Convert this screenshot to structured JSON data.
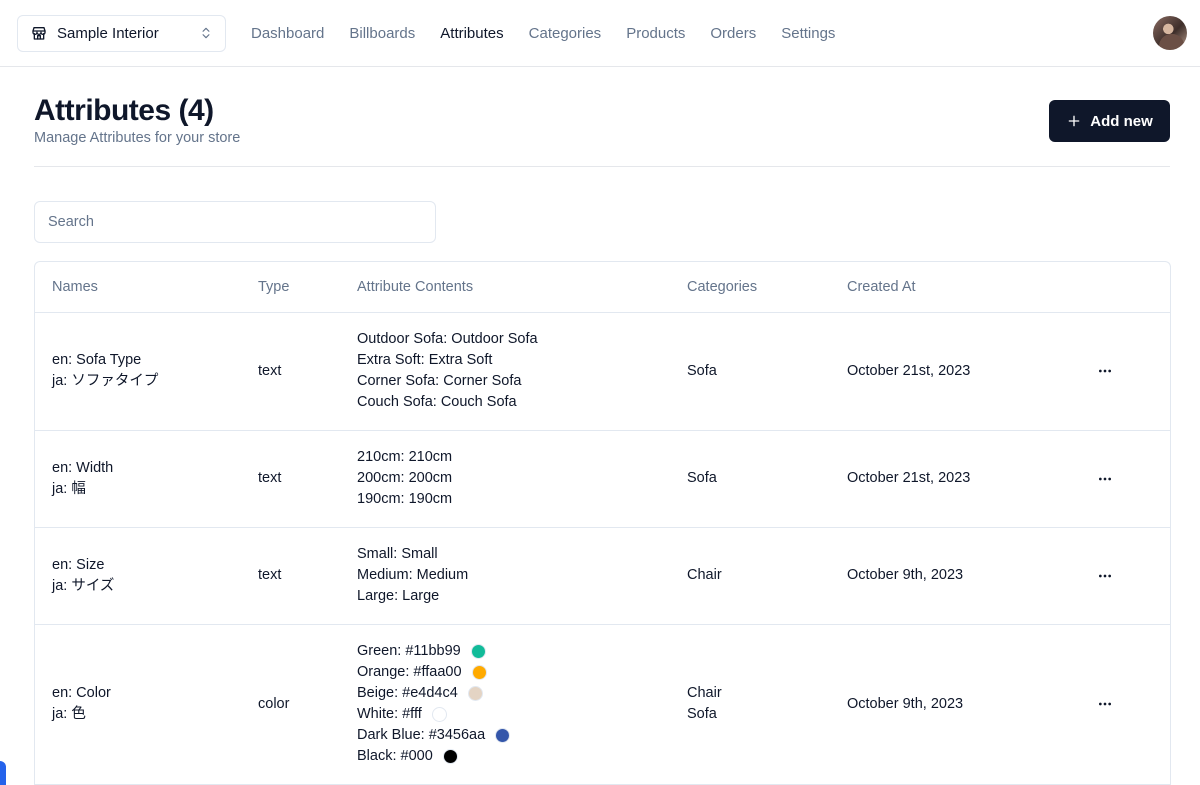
{
  "store_switcher": {
    "name": "Sample Interior",
    "icon": "store-icon",
    "chevron_icon": "chevrons-up-down-icon"
  },
  "nav": [
    {
      "label": "Dashboard",
      "active": false
    },
    {
      "label": "Billboards",
      "active": false
    },
    {
      "label": "Attributes",
      "active": true
    },
    {
      "label": "Categories",
      "active": false
    },
    {
      "label": "Products",
      "active": false
    },
    {
      "label": "Orders",
      "active": false
    },
    {
      "label": "Settings",
      "active": false
    }
  ],
  "header": {
    "title": "Attributes (4)",
    "description": "Manage Attributes for your store",
    "add_button": "Add new"
  },
  "search": {
    "placeholder": "Search",
    "value": ""
  },
  "table": {
    "columns": [
      "Names",
      "Type",
      "Attribute Contents",
      "Categories",
      "Created At"
    ],
    "rows": [
      {
        "names": [
          "en: Sofa Type",
          "ja: ソファタイプ"
        ],
        "type": "text",
        "contents": [
          {
            "label": "Outdoor Sofa: Outdoor Sofa"
          },
          {
            "label": "Extra Soft: Extra Soft"
          },
          {
            "label": "Corner Sofa: Corner Sofa"
          },
          {
            "label": "Couch Sofa: Couch Sofa"
          }
        ],
        "categories": [
          "Sofa"
        ],
        "created_at": "October 21st, 2023"
      },
      {
        "names": [
          "en: Width",
          "ja: 幅"
        ],
        "type": "text",
        "contents": [
          {
            "label": "210cm: 210cm"
          },
          {
            "label": "200cm: 200cm"
          },
          {
            "label": "190cm: 190cm"
          }
        ],
        "categories": [
          "Sofa"
        ],
        "created_at": "October 21st, 2023"
      },
      {
        "names": [
          "en: Size",
          "ja: サイズ"
        ],
        "type": "text",
        "contents": [
          {
            "label": "Small: Small"
          },
          {
            "label": "Medium: Medium"
          },
          {
            "label": "Large: Large"
          }
        ],
        "categories": [
          "Chair"
        ],
        "created_at": "October 9th, 2023"
      },
      {
        "names": [
          "en: Color",
          "ja: 色"
        ],
        "type": "color",
        "contents": [
          {
            "label": "Green: #11bb99",
            "color": "#11bb99"
          },
          {
            "label": "Orange: #ffaa00",
            "color": "#ffaa00"
          },
          {
            "label": "Beige: #e4d4c4",
            "color": "#e4d4c4"
          },
          {
            "label": "White: #fff",
            "color": "#ffffff"
          },
          {
            "label": "Dark Blue: #3456aa",
            "color": "#3456aa"
          },
          {
            "label": "Black: #000",
            "color": "#000000"
          }
        ],
        "categories": [
          "Chair",
          "Sofa"
        ],
        "created_at": "October 9th, 2023"
      }
    ]
  }
}
